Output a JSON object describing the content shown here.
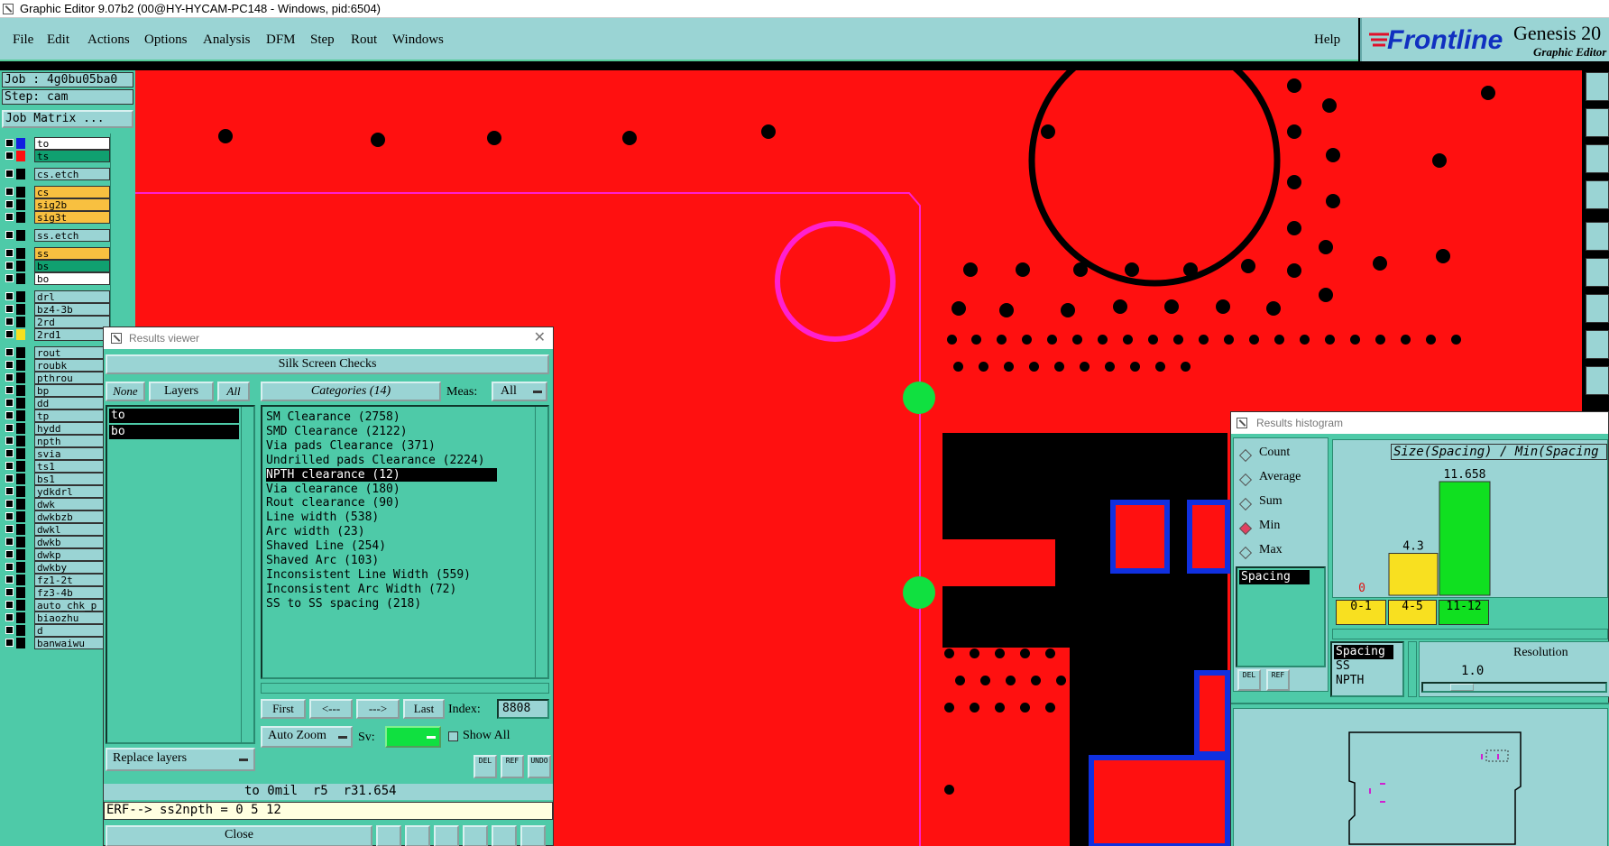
{
  "window": {
    "title": "Graphic Editor 9.07b2 (00@HY-HYCAM-PC148 - Windows, pid:6504)"
  },
  "menu": {
    "items": [
      "File",
      "Edit",
      "Actions",
      "Options",
      "Analysis",
      "DFM",
      "Step",
      "Rout",
      "Windows"
    ],
    "help": "Help"
  },
  "logo": {
    "brand": "Frontline",
    "product": "Genesis 20",
    "subtitle": "Graphic Editor"
  },
  "job": {
    "job": "Job  : 4g0bu05ba0",
    "step": "Step: cam",
    "matrix_button": "Job Matrix ..."
  },
  "layers": [
    {
      "name": "to",
      "color": "#1020e0",
      "active": true
    },
    {
      "name": "ts",
      "color": "#ff1010"
    },
    {
      "name": "cs.etch",
      "color": "#000000"
    },
    {
      "name": "cs",
      "color": "#000000"
    },
    {
      "name": "sig2b",
      "color": "#000000"
    },
    {
      "name": "sig3t",
      "color": "#000000"
    },
    {
      "name": "ss.etch",
      "color": "#000000"
    },
    {
      "name": "ss",
      "color": "#000000"
    },
    {
      "name": "bs",
      "color": "#000000"
    },
    {
      "name": "bo",
      "color": "#000000"
    },
    {
      "name": "drl",
      "color": "#000000"
    },
    {
      "name": "bz4-3b",
      "color": "#000000"
    },
    {
      "name": "2rd",
      "color": "#000000"
    },
    {
      "name": "2rd1",
      "color": "#f8e020"
    },
    {
      "name": "rout",
      "color": "#000000"
    },
    {
      "name": "roubk",
      "color": "#000000"
    },
    {
      "name": "pthrou",
      "color": "#000000"
    },
    {
      "name": "bp",
      "color": "#000000"
    },
    {
      "name": "dd",
      "color": "#000000"
    },
    {
      "name": "tp",
      "color": "#000000"
    },
    {
      "name": "hydd",
      "color": "#000000"
    },
    {
      "name": "npth",
      "color": "#000000"
    },
    {
      "name": "svia",
      "color": "#000000"
    },
    {
      "name": "ts1",
      "color": "#000000"
    },
    {
      "name": "bs1",
      "color": "#000000"
    },
    {
      "name": "ydkdrl",
      "color": "#000000"
    },
    {
      "name": "dwk",
      "color": "#000000"
    },
    {
      "name": "dwkbzb",
      "color": "#000000"
    },
    {
      "name": "dwkl",
      "color": "#000000"
    },
    {
      "name": "dwkb",
      "color": "#000000"
    },
    {
      "name": "dwkp",
      "color": "#000000"
    },
    {
      "name": "dwkby",
      "color": "#000000"
    },
    {
      "name": "fz1-2t",
      "color": "#000000"
    },
    {
      "name": "fz3-4b",
      "color": "#000000"
    },
    {
      "name": "auto_chk_p",
      "color": "#000000"
    },
    {
      "name": "biaozhu",
      "color": "#000000"
    },
    {
      "name": "d",
      "color": "#000000"
    },
    {
      "name": "banwaiwu",
      "color": "#000000"
    }
  ],
  "results_viewer": {
    "title": "Results viewer",
    "header": "Silk Screen Checks",
    "none_btn": "None",
    "layers_btn": "Layers",
    "all_btn": "All",
    "layer_list": [
      "to",
      "bo"
    ],
    "categories_label": "Categories (14)",
    "meas_label": "Meas:",
    "meas_value": "All",
    "categories": [
      "SM Clearance (2758)",
      "SMD Clearance (2122)",
      "Via pads Clearance (371)",
      "Undrilled pads Clearance (2224)",
      "NPTH clearance (12)",
      "Via clearance (180)",
      "Rout clearance (90)",
      "Line width (538)",
      "Arc width (23)",
      "Shaved Line (254)",
      "Shaved Arc (103)",
      "Inconsistent Line Width (559)",
      "Inconsistent Arc Width (72)",
      "SS to SS spacing (218)"
    ],
    "selected_index": 4,
    "first_btn": "First",
    "prev_btn": "<---",
    "next_btn": "--->",
    "last_btn": "Last",
    "index_label": "Index:",
    "index_value": "8808",
    "autozoom": "Auto Zoom",
    "sv_label": "Sv:",
    "show_all": "Show All",
    "replace_layers": "Replace layers",
    "status_line": "to 0mil  r5  r31.654",
    "erf_line": "ERF--> ss2npth = 0 5 12",
    "close_btn": "Close",
    "del_btn": "DEL",
    "ref_btn": "REF",
    "undo_btn": "UNDO"
  },
  "histogram": {
    "title": "Results histogram",
    "modes": [
      "Count",
      "Average",
      "Sum",
      "Min",
      "Max"
    ],
    "selected_mode": "Min",
    "attr_selected": "Spacing",
    "chart_title": "Size(Spacing) / Min(Spacing",
    "attr_list": [
      "Spacing",
      "SS",
      "NPTH"
    ],
    "resolution_label": "Resolution",
    "resolution_value": "1.0",
    "del_btn": "DEL",
    "ref_btn": "REF"
  },
  "chart_data": {
    "type": "bar",
    "title": "Size(Spacing) / Min(Spacing",
    "categories": [
      "0-1",
      "4-5",
      "11-12"
    ],
    "values": [
      0,
      4.3,
      11.658
    ],
    "value_labels": [
      "0",
      "4.3",
      "11.658"
    ],
    "colors": [
      "#f8e020",
      "#f8e020",
      "#10e020"
    ]
  }
}
